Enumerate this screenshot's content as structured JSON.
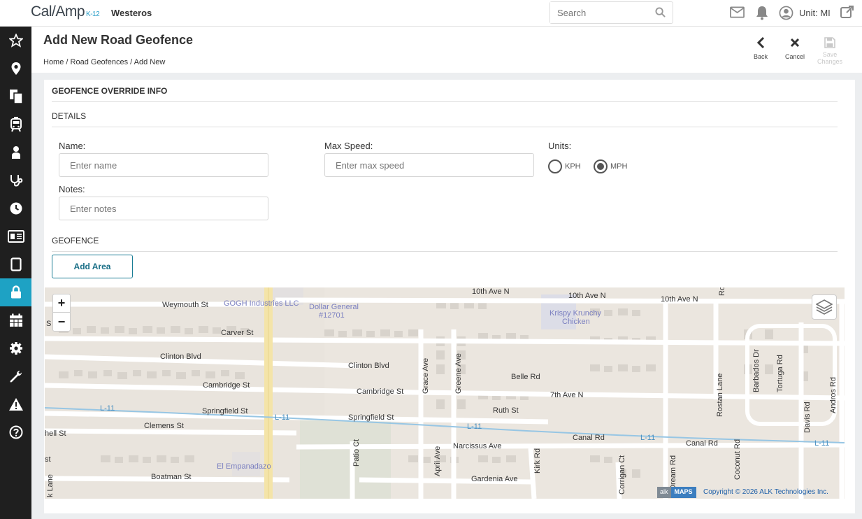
{
  "app": {
    "logo_main": "Cal/Amp",
    "logo_sub": "K-12",
    "org": "Westeros"
  },
  "search": {
    "placeholder": "Search"
  },
  "header": {
    "unit_label": "Unit: MI"
  },
  "sidebar": {
    "items": [
      "star-icon",
      "location-pin-icon",
      "documents-icon",
      "bus-icon",
      "student-icon",
      "stethoscope-icon",
      "clock-icon",
      "id-card-icon",
      "tablet-icon",
      "lock-icon",
      "calendar-icon",
      "gear-icon",
      "wrench-icon",
      "warning-icon",
      "help-icon"
    ],
    "active_index": 9
  },
  "page": {
    "title": "Add New Road Geofence",
    "breadcrumb": [
      "Home",
      "Road Geofences",
      "Add New"
    ],
    "breadcrumb_sep": "/",
    "actions": {
      "back": "Back",
      "cancel": "Cancel",
      "save": "Save Changes"
    }
  },
  "form": {
    "section_title": "GEOFENCE OVERRIDE INFO",
    "details_title": "DETAILS",
    "name_label": "Name:",
    "name_placeholder": "Enter name",
    "maxspeed_label": "Max Speed:",
    "maxspeed_placeholder": "Enter max speed",
    "units_label": "Units:",
    "unit_kph": "KPH",
    "unit_mph": "MPH",
    "units_selected": "MPH",
    "notes_label": "Notes:",
    "notes_placeholder": "Enter notes",
    "geofence_title": "GEOFENCE",
    "add_area": "Add Area"
  },
  "map": {
    "zoom_in": "+",
    "zoom_out": "−",
    "copyright": "Copyright © 2026 ALK Technologies Inc.",
    "logo_a": "alk",
    "logo_b": "MAPS",
    "labels": {
      "weymouth": "Weymouth St",
      "gogh": "GOGH Industries LLC",
      "dollar": "Dollar General",
      "dollar2": "#12701",
      "tenth1": "10th Ave N",
      "tenth2": "10th Ave N",
      "tenth3": "10th Ave N",
      "krispy": "Krispy Krunchy",
      "krispy2": "Chicken",
      "carver": "Carver St",
      "clinton1": "Clinton Blvd",
      "clinton2": "Clinton Blvd",
      "cambridge1": "Cambridge St",
      "cambridge2": "Cambridge St",
      "grace": "Grace Ave",
      "greene": "Greene Ave",
      "belle": "Belle Rd",
      "seventh": "7th Ave N",
      "ruth": "Ruth St",
      "springfield1": "Springfield St",
      "springfield2": "Springfield St",
      "l11a": "L-11",
      "l11b": "L-11",
      "l11c": "L-11",
      "l11d": "L-11",
      "l11e": "L-11",
      "clemens": "Clemens St",
      "hell": "hell St",
      "narcissus": "Narcissus Ave",
      "canal1": "Canal Rd",
      "canal2": "Canal Rd",
      "patio": "Patio Ct",
      "april": "April Ave",
      "kirk": "Kirk Rd",
      "empanadazo": "El Empanadazo",
      "boatman": "Boatman St",
      "gardenia": "Gardenia Ave",
      "corrigan": "Corrigan Ct",
      "dream": "Dream Rd",
      "coconut": "Coconut Rd",
      "rostan": "Rostan Lane",
      "barbados": "Barbados Dr",
      "tortuga": "Tortuga Rd",
      "davis": "Davis Rd",
      "andros": "Andros Rd",
      "klane": "k Lane",
      "st": "st",
      "s": "S",
      "ro": "Ro"
    }
  }
}
